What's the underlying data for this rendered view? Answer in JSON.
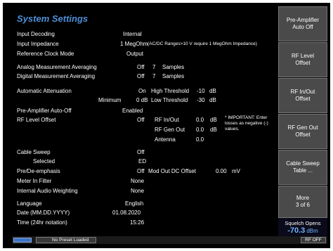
{
  "title": "System Settings",
  "rows": {
    "input_decoding": {
      "label": "Input Decoding",
      "value": "Internal"
    },
    "input_impedance": {
      "label": "Input Impedance",
      "value": "1 MegOhm",
      "note": "(AC/DC Ranges>10 V require 1 MegOhm Impedance)"
    },
    "ref_clock": {
      "label": "Reference Clock Mode",
      "value": "Output"
    },
    "analog_avg": {
      "label": "Analog Measurement Averaging",
      "value": "Off",
      "count": "7",
      "unit": "Samples"
    },
    "digital_avg": {
      "label": "Digital Measurement Averaging",
      "value": "Off",
      "count": "7",
      "unit": "Samples"
    },
    "auto_atten": {
      "label": "Automatic Attenuation",
      "value": "On",
      "high_label": "High Threshold",
      "high_val": "-10",
      "high_unit": "dB"
    },
    "minimum": {
      "label": "Minimum",
      "value": "0 dB",
      "low_label": "Low Threshold",
      "low_val": "-30",
      "low_unit": "dB"
    },
    "preamp_auto_off": {
      "label": "Pre-Amplifier Auto-Off",
      "value": "Enabled"
    },
    "rf_level_offset": {
      "label": "RF Level Offset",
      "value": "Off"
    },
    "rf_in_out": {
      "label": "RF In/Out",
      "value": "0.0",
      "unit": "dB"
    },
    "rf_gen_out": {
      "label": "RF Gen Out",
      "value": "0.0",
      "unit": "dB"
    },
    "antenna": {
      "label": "Antenna",
      "value": "0.0"
    },
    "important": "* IMPORTANT: Enter losses as negative (-) values.",
    "cable_sweep": {
      "label": "Cable Sweep",
      "value": "Off"
    },
    "selected": {
      "label": "Selected",
      "value": "ED"
    },
    "pre_de_emphasis": {
      "label": "Pre/De-emphasis",
      "value": "Off",
      "mod_label": "Mod Out DC Offset",
      "mod_val": "0.00",
      "mod_unit": "mV"
    },
    "meter_filter": {
      "label": "Meter In Filter",
      "value": "None"
    },
    "audio_weighting": {
      "label": "Internal Audio Weighting",
      "value": "None"
    },
    "language": {
      "label": "Language",
      "value": "English"
    },
    "date": {
      "label": "Date (MM.DD.YYYY)",
      "value": "01.08.2020"
    },
    "time": {
      "label": "Time (24hr notation)",
      "value": "15:26"
    }
  },
  "softkeys": [
    "Pre-Amplifier\nAuto Off",
    "RF Level\nOffset",
    "RF In/Out\nOffset",
    "RF Gen Out\nOffset",
    "Cable Sweep\nTable ...",
    "More\n3 of 6"
  ],
  "squelch": {
    "label": "Squelch Opens",
    "value": "-70.3",
    "unit": "dBm"
  },
  "status": {
    "preset": "No Preset Loaded",
    "rf": "RF OFF"
  },
  "colors": {
    "title": "#4f8fd8",
    "accent": "#6fb4ff",
    "softkey_bg": "#4a4a4a"
  }
}
